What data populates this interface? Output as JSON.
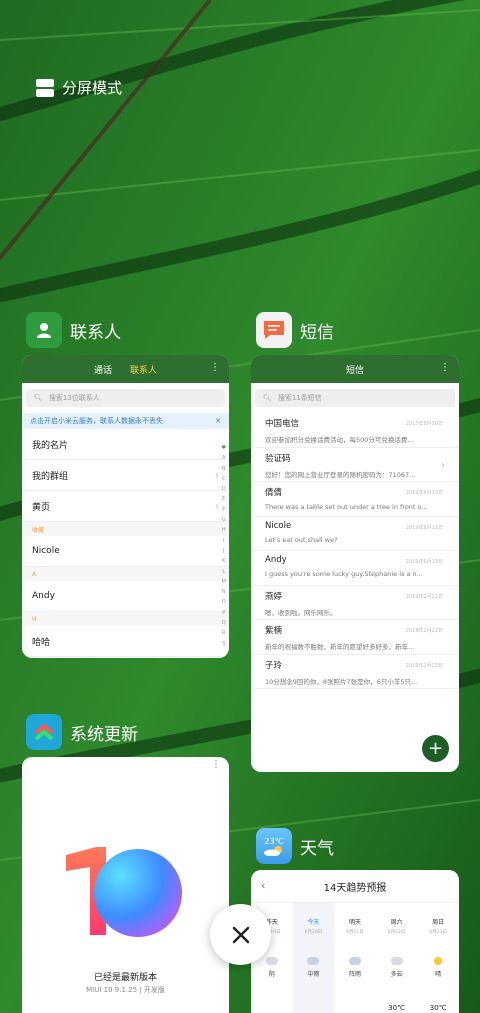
{
  "split_mode": {
    "label": "分屏模式"
  },
  "contacts_app": {
    "name": "联系人",
    "tabs": [
      "通话",
      "联系人"
    ],
    "search_placeholder": "搜索13位联系人",
    "banner": "点击开启小米云服务，联系人数据永不丢失",
    "rows": [
      {
        "type": "row",
        "label": "我的名片"
      },
      {
        "type": "row",
        "label": "我的群组",
        "chevron": true
      },
      {
        "type": "row",
        "label": "黄页",
        "chevron": true
      },
      {
        "type": "section",
        "label": "收藏"
      },
      {
        "type": "row",
        "label": "Nicole"
      },
      {
        "type": "section",
        "label": "A"
      },
      {
        "type": "row",
        "label": "Andy"
      },
      {
        "type": "section",
        "label": "H"
      },
      {
        "type": "row",
        "label": "哈哈"
      }
    ],
    "alphabet": [
      "♥",
      "A",
      "B",
      "C",
      "D",
      "E",
      "F",
      "G",
      "H",
      "I",
      "J",
      "K",
      "L",
      "M",
      "N",
      "O",
      "P",
      "Q",
      "R",
      "S"
    ]
  },
  "sms_app": {
    "name": "短信",
    "header": "短信",
    "search_placeholder": "搜索11条短信",
    "messages": [
      {
        "name": "中国电信",
        "preview": "欢迎参加积分兑换话费活动，每500分可兑换话费...",
        "date": "2017年8月30日"
      },
      {
        "name": "验证码",
        "preview": "您好！您的网上营业厅登录的随机密码为：71067...",
        "date": "",
        "chevron": true
      },
      {
        "name": "倩倩",
        "preview": "There was a table set out under a tree in front o...",
        "date": "2019年6月13日"
      },
      {
        "name": "Nicole",
        "preview": "Let's eat out,shall we?",
        "date": "2019年6月13日"
      },
      {
        "name": "Andy",
        "preview": "I guess you're some lucky guy.Stephanie is a n...",
        "date": "2019年6月13日"
      },
      {
        "name": "燕婷",
        "preview": "嗯，收到啦。网乐网乐。",
        "date": "2019年2月22日"
      },
      {
        "name": "紫楠",
        "preview": "新年的祝福数不胜数，新年的愿望好多好多，新年...",
        "date": "2019年2月22日"
      },
      {
        "name": "子玲",
        "preview": "10分想念9回的你，8张照片7张是你，6只小羊5只...",
        "date": "2019年2月22日"
      }
    ],
    "fab": "+"
  },
  "update_app": {
    "name": "系统更新",
    "status": "已经是最新版本",
    "version": "MIUI 10 9.1.25 | 开发版"
  },
  "weather_app": {
    "name": "天气",
    "icon_temp": "23℃",
    "title": "14天趋势预报",
    "days": [
      {
        "day": "昨天",
        "date": "6月19日",
        "desc": "阴",
        "temp": ""
      },
      {
        "day": "今天",
        "date": "6月20日",
        "desc": "中雨",
        "temp": ""
      },
      {
        "day": "明天",
        "date": "6月21日",
        "desc": "阵雨",
        "temp": ""
      },
      {
        "day": "周六",
        "date": "6月22日",
        "desc": "多云",
        "temp": "30℃"
      },
      {
        "day": "周日",
        "date": "6月23日",
        "desc": "晴",
        "temp": "30℃"
      }
    ]
  },
  "close_button": {
    "icon": "close-icon"
  },
  "colors": {
    "header_green": "#2e6f30",
    "accent_yellow": "#ffd24d",
    "fab_green": "#1f5e25",
    "banner_blue": "#2d7fd1"
  }
}
